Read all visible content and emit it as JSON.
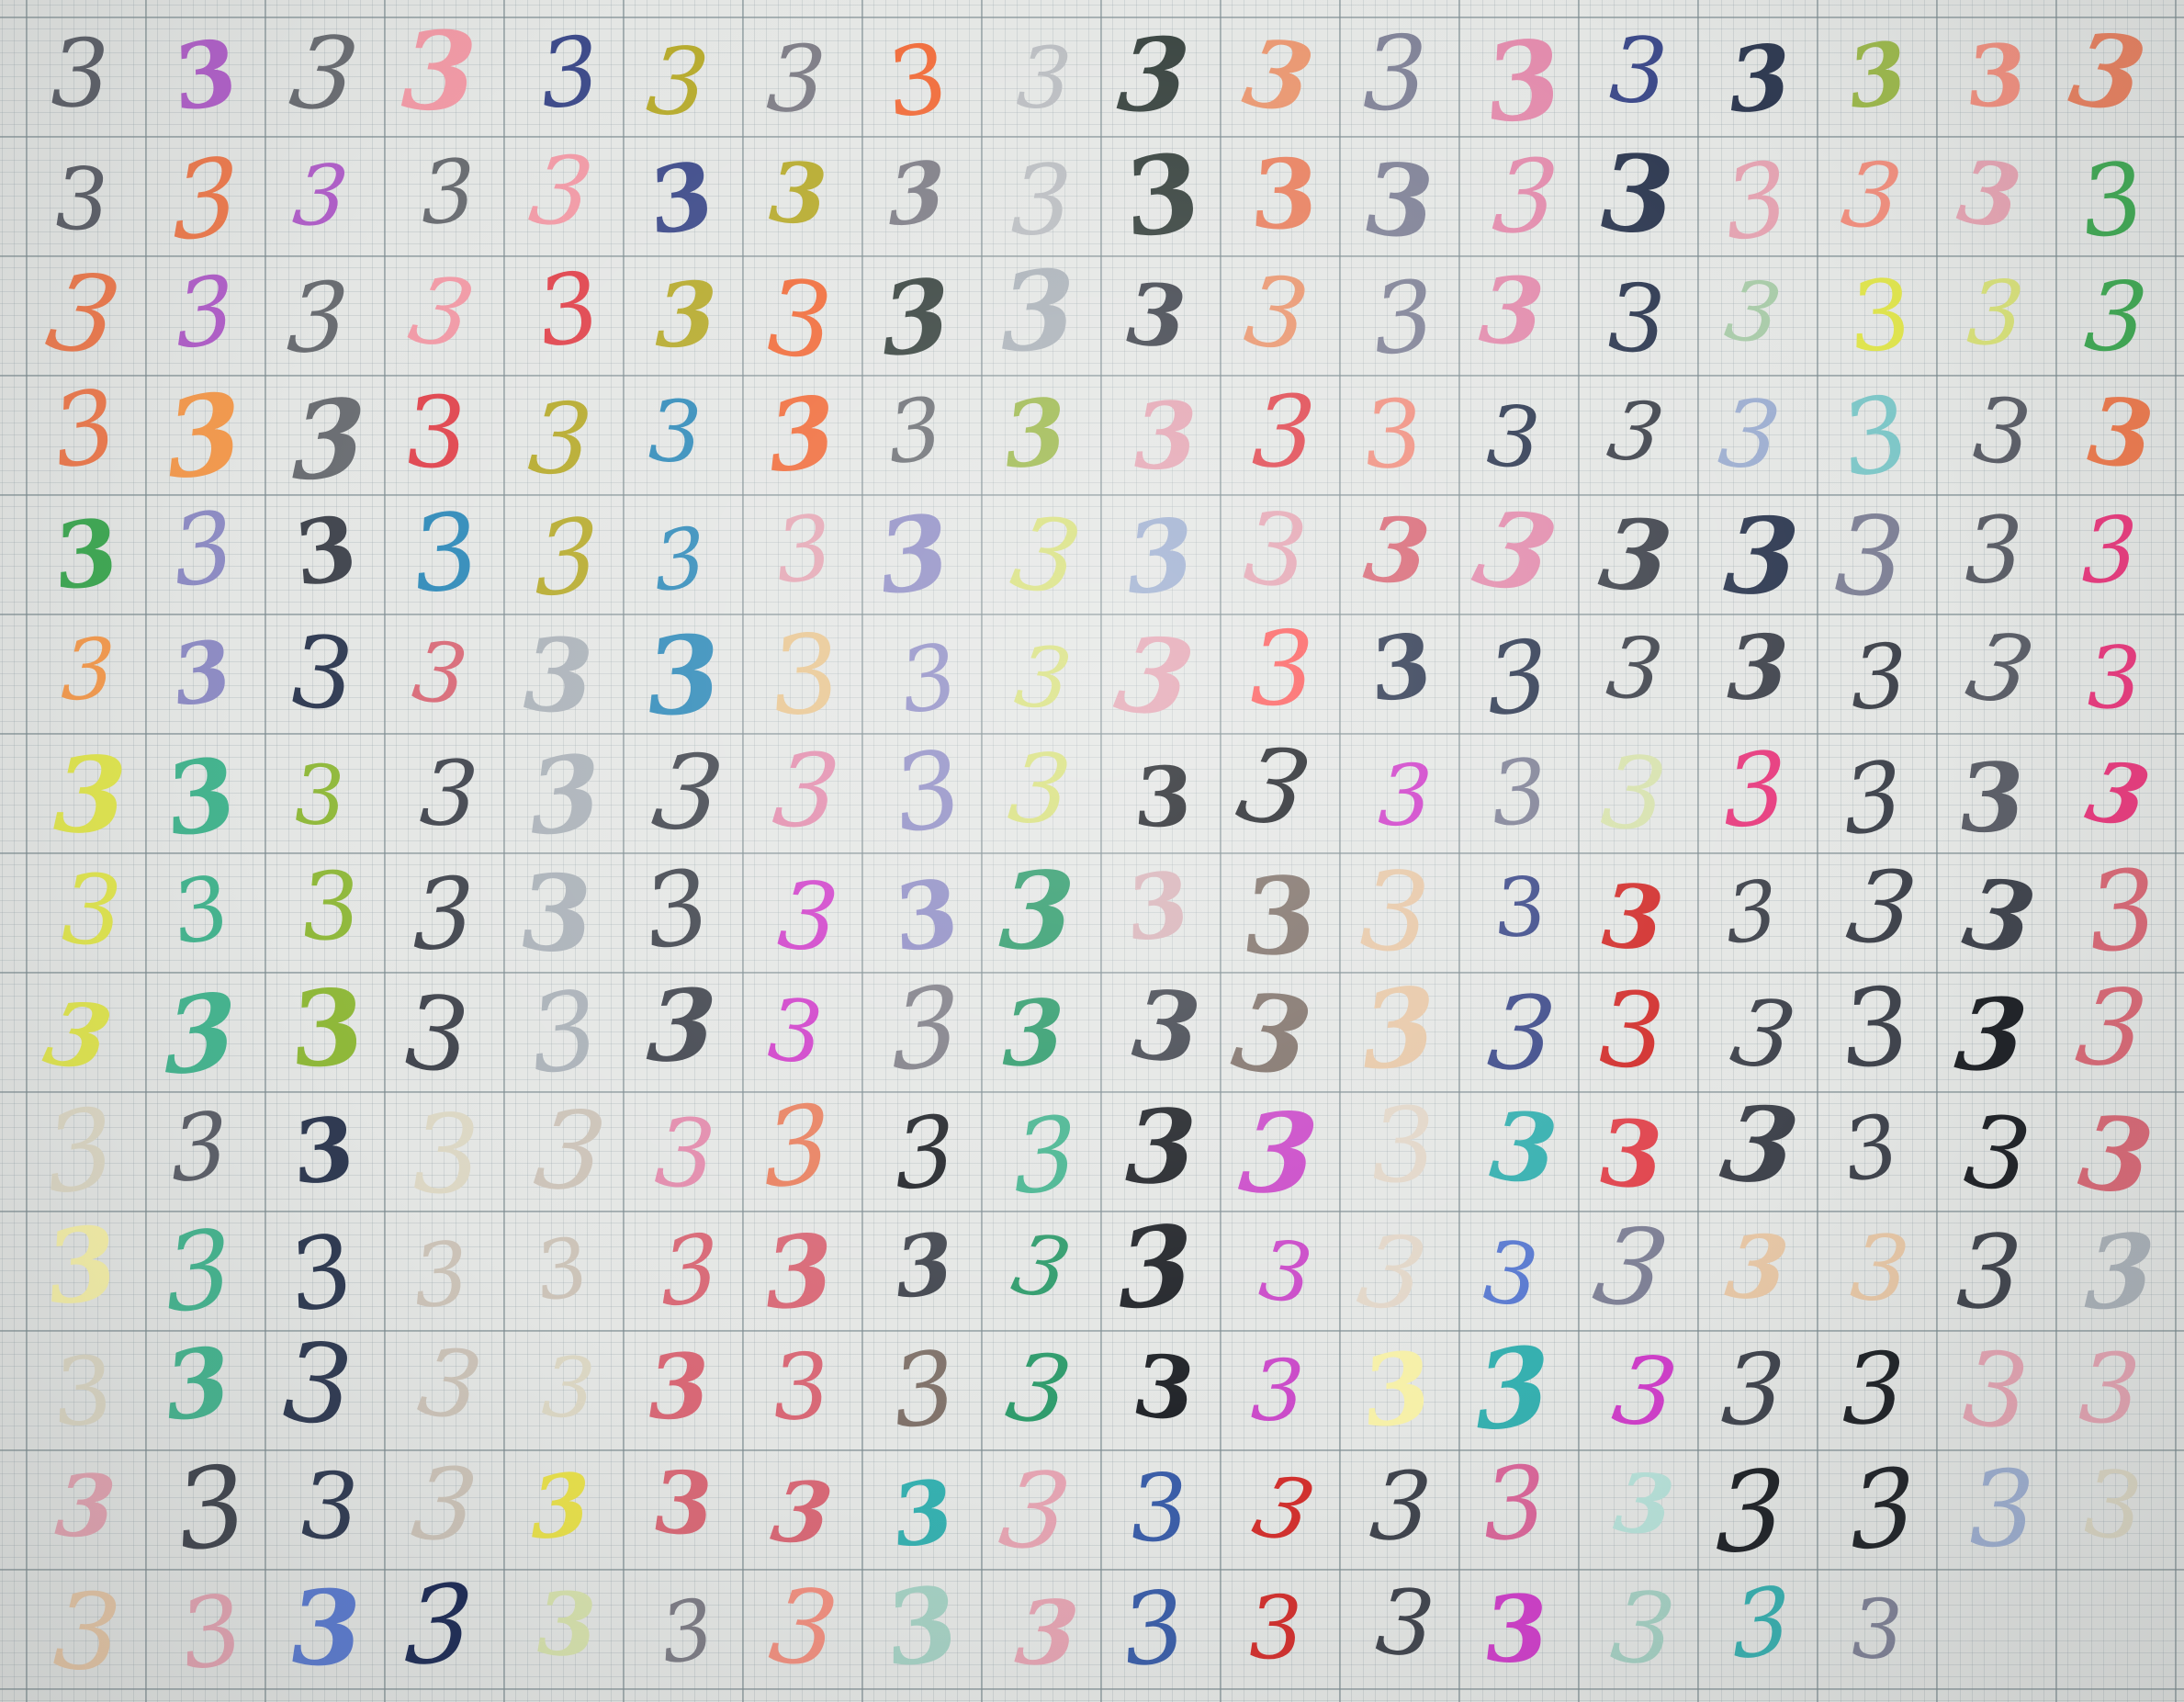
{
  "digit": "3",
  "palette": {
    "a": "#5c5f68",
    "b": "#ec7a4e",
    "c": "#b05fc8",
    "d": "#6a6d72",
    "e": "#f19aa6",
    "f": "#3e4b8a",
    "g": "#b6aa2c",
    "h": "#7d7c85",
    "i": "#f06a38",
    "j": "#b9bcc0",
    "k": "#35403c",
    "l": "#e9956e",
    "m": "#7f8196",
    "n": "#e28bac",
    "o": "#2f3a52",
    "p": "#9cb84c",
    "q": "#f08f7f",
    "r": "#e8805f",
    "s": "#3fa853",
    "t": "#f39a4f",
    "u": "#dcd7c4",
    "v": "#d7e07a",
    "w": "#9daed0",
    "x": "#a9cba9",
    "y": "#7fc7c8",
    "z": "#2f8ab9",
    "A": "#8e8cc4",
    "B": "#d86876",
    "C": "#e0454e",
    "D": "#aab1b8",
    "E": "#d7e2ad",
    "F": "#e73b7e",
    "G": "#dfe44f",
    "H": "#45b48f",
    "I": "#8fb83a",
    "J": "#40444d",
    "K": "#5a7ad0",
    "L": "#e8c58f",
    "M": "#1f2227",
    "N": "#cf3ec9",
    "O": "#e7c7a6",
    "P": "#e4a4b2",
    "Q": "#7f7169",
    "R": "#2c9a6a",
    "S": "#ccc3b8",
    "T": "#ca49c8",
    "U": "#d2302e",
    "V": "#6e4a4e",
    "W": "#3b5ea8",
    "X": "#b7e1d9",
    "Y": "#36b0b0",
    "Z": "#cf9ad0",
    "0": "#e8e04a",
    "1": "#c89a30",
    "2": "#e2d6c8",
    "3": "#d96699",
    "4": "#a5d0c3",
    "5": "#f6f0a8",
    "6": "#d8b2b8",
    "7": "#fc5e5e",
    "8": "#1c2a55",
    "9": "#e73d7c"
  },
  "rows": [
    "acdefghijklmnfopqr",
    "abcdefghjkrmnoPqP",
    "sbcdeCgikDJlmnoxGv",
    "sbtdCgzidpPCqoJwy",
    "absAJzgzPAvwPBnJom",
    "aFtAoBDzLAvP7ooJJJ",
    "aFGHIJDJnAvMMNmEFJ",
    "aFGHIJDJNAR6QOfUJJ",
    "JBGHIJDJNhRJQOfUJJ",
    "MBuaouSnrMHMT2YCJJ",
    "MB5HoSSBBJRMT2KmOO",
    "JDuHoSuBBQRMT5YNJM",
    "PPPJoS0BBYPWUJ3XMM",
    "wuOPK8Ehq4PWUJN4Ym"
  ]
}
